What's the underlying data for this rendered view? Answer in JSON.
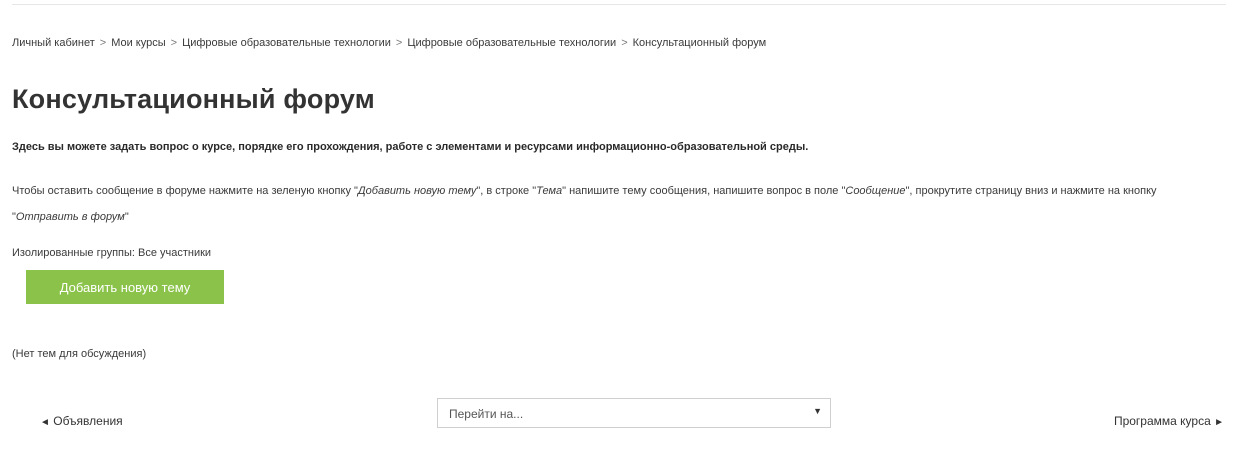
{
  "breadcrumb": {
    "items": [
      "Личный кабинет",
      "Мои курсы",
      "Цифровые образовательные технологии",
      "Цифровые образовательные технологии",
      "Консультационный форум"
    ],
    "separator": ">"
  },
  "page": {
    "title": "Консультационный форум",
    "intro": "Здесь вы можете задать вопрос о курсе, порядке его прохождения, работе с элементами и ресурсами информационно-образовательной среды.",
    "instructions": {
      "t1": "Чтобы оставить сообщение в форуме нажмите на зеленую кнопку \"",
      "e1": "Добавить новую тему",
      "t2": "\", в строке \"",
      "e2": "Тема",
      "t3": "\" напишите тему сообщения, напишите вопрос в поле \"",
      "e3": "Сообщение",
      "t4": "\", прокрутите страницу вниз и нажмите на кнопку \"",
      "e4": "Отправить в форум",
      "t5": "\""
    },
    "groups_label": "Изолированные группы: Все участники",
    "add_topic_label": "Добавить новую тему",
    "no_topics": "(Нет тем для обсуждения)"
  },
  "nav": {
    "prev_arrow": "◄",
    "prev_label": "Объявления",
    "jump_placeholder": "Перейти на...",
    "jump_caret": "▼",
    "next_label": "Программа курса",
    "next_arrow": "►"
  },
  "colors": {
    "accent_button": "#8bc34a"
  }
}
